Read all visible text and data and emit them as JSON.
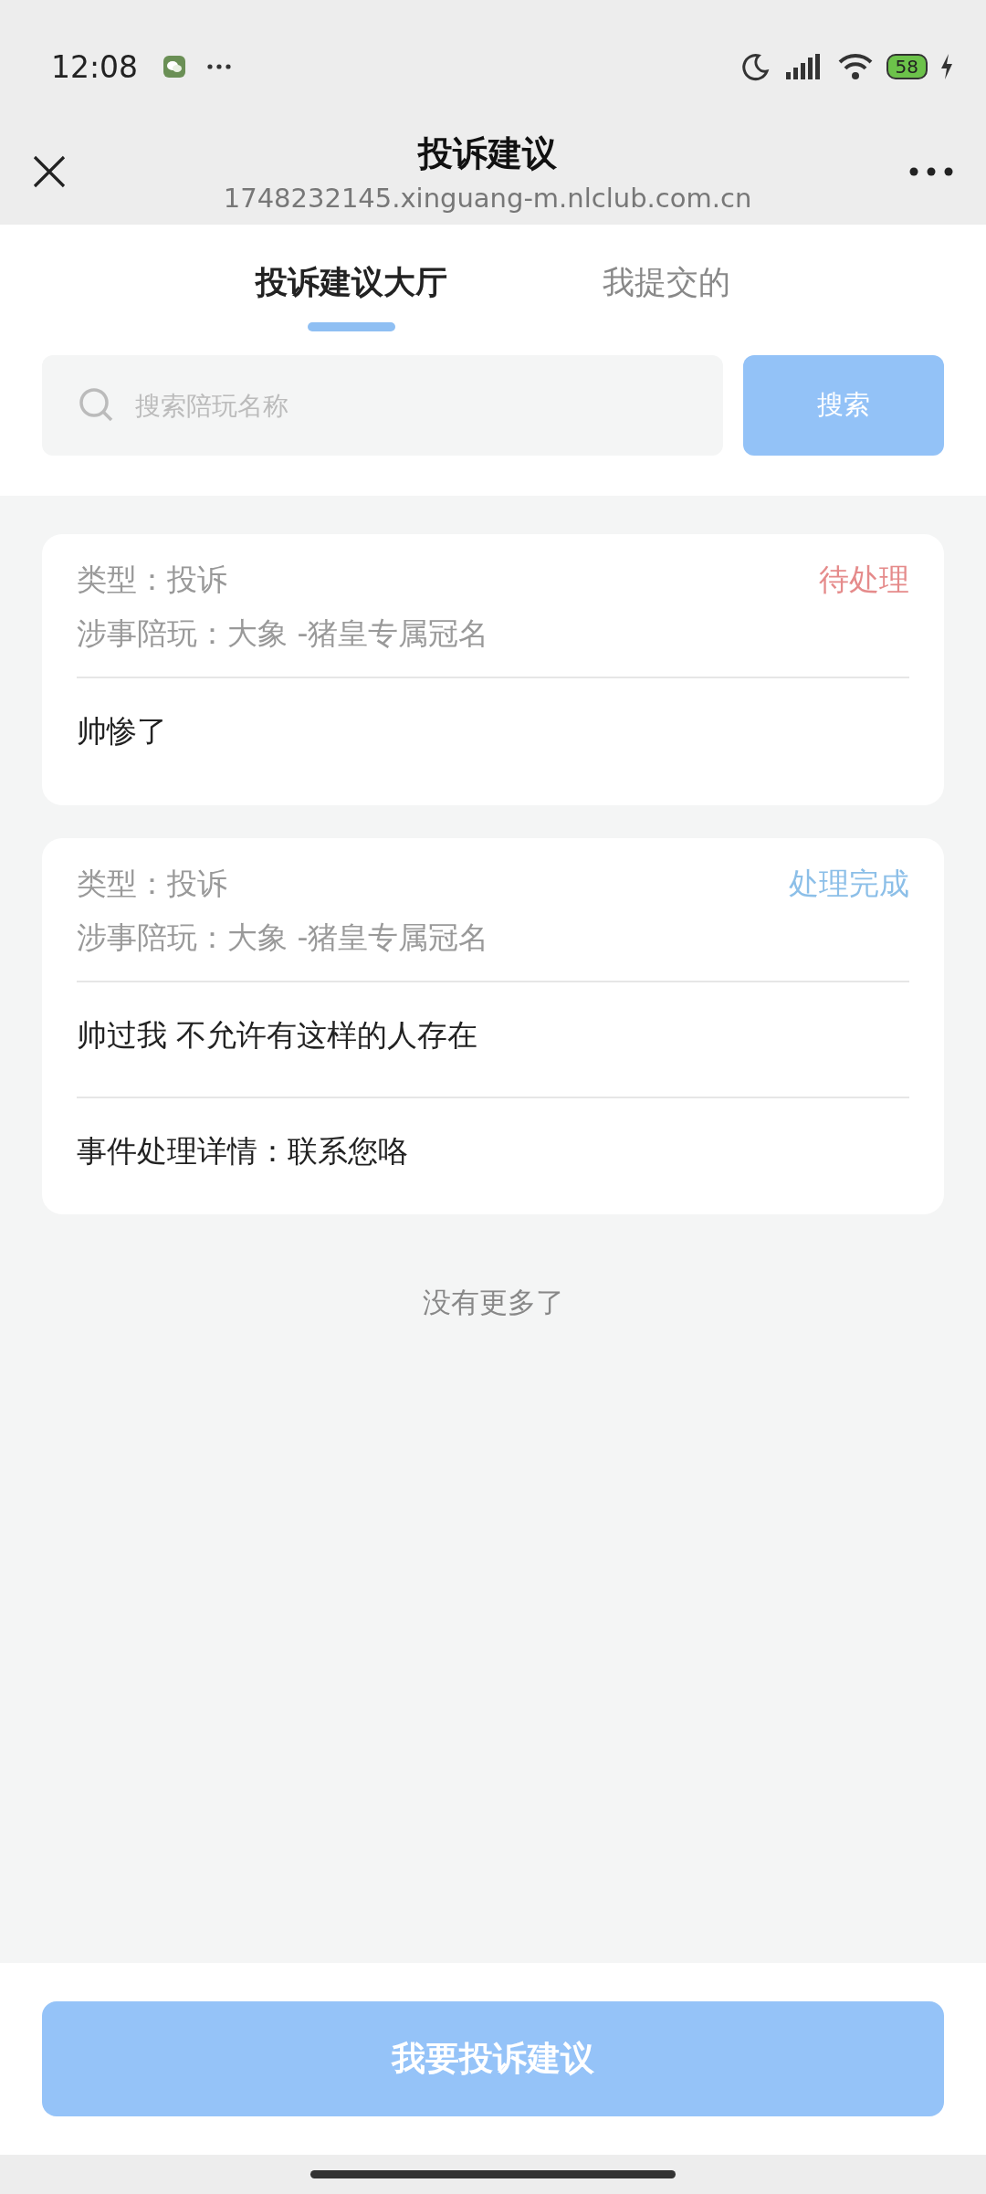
{
  "status_bar": {
    "time": "12:08",
    "battery": "58"
  },
  "header": {
    "title": "投诉建议",
    "url": "1748232145.xinguang-m.nlclub.com.cn"
  },
  "tabs": [
    {
      "label": "投诉建议大厅",
      "selected": true
    },
    {
      "label": "我提交的",
      "selected": false
    }
  ],
  "search": {
    "placeholder": "搜索陪玩名称",
    "button": "搜索"
  },
  "cards": [
    {
      "type": "类型：投诉",
      "companion": "涉事陪玩：大象 -猪皇专属冠名",
      "status": "待处理",
      "kind": "pending",
      "content": "帅惨了"
    },
    {
      "type": "类型：投诉",
      "companion": "涉事陪玩：大象 -猪皇专属冠名",
      "status": "处理完成",
      "kind": "done",
      "content": "帅过我 不允许有这样的人存在",
      "detail": "事件处理详情：联系您咯"
    }
  ],
  "end_note": "没有更多了",
  "submit_button": "我要投诉建议"
}
